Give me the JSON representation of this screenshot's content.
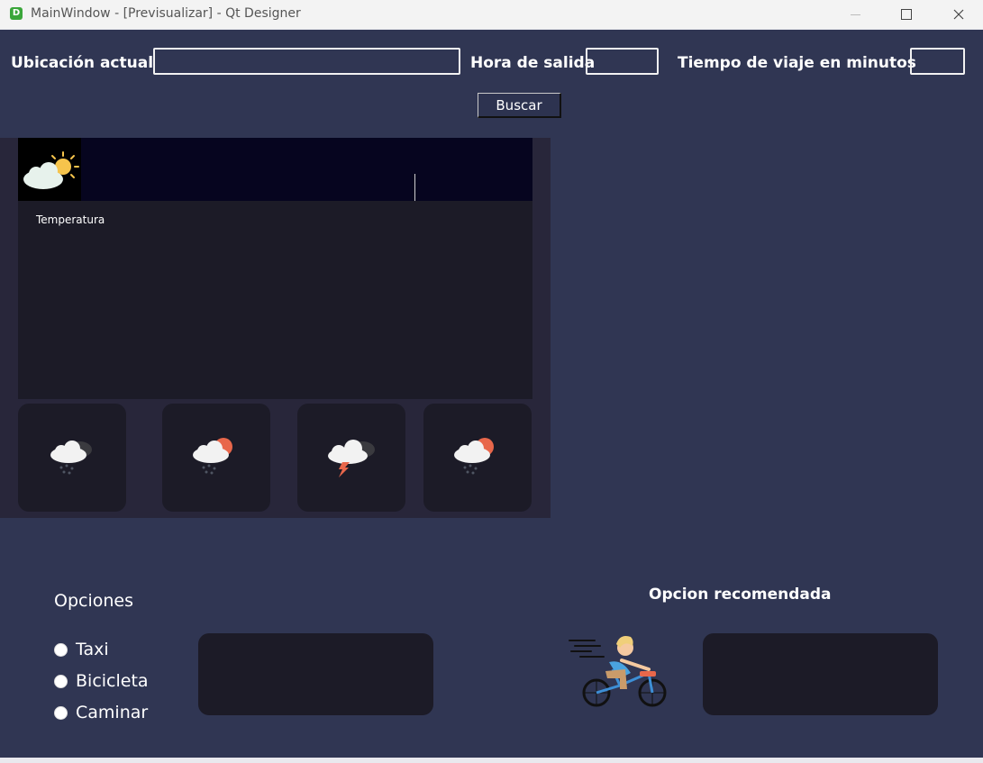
{
  "window": {
    "title": "MainWindow - [Previsualizar] - Qt Designer",
    "app_icon_letter": "D"
  },
  "search": {
    "location_label": "Ubicación actual",
    "location_value": "",
    "departure_label": "Hora de salida",
    "departure_value": "",
    "travel_time_label": "Tiempo de viaje en minutos",
    "travel_time_value": "",
    "search_button": "Buscar"
  },
  "weather": {
    "current_icon": "partly-cloudy-sun-icon",
    "temperature_label": "Temperatura",
    "forecast": [
      {
        "icon": "rain-cloud-icon"
      },
      {
        "icon": "sun-cloud-rain-icon"
      },
      {
        "icon": "thunderstorm-icon"
      },
      {
        "icon": "sun-cloud-rain-icon"
      }
    ]
  },
  "options": {
    "title": "Opciones",
    "items": [
      {
        "label": "Taxi",
        "checked": false
      },
      {
        "label": "Bicicleta",
        "checked": false
      },
      {
        "label": "Caminar",
        "checked": false
      }
    ]
  },
  "recommendation": {
    "title": "Opcion recomendada",
    "icon": "cyclist-icon"
  },
  "colors": {
    "window_bg": "#303653",
    "panel_dark": "#1c1b27",
    "weather_panel": "#28263a"
  }
}
